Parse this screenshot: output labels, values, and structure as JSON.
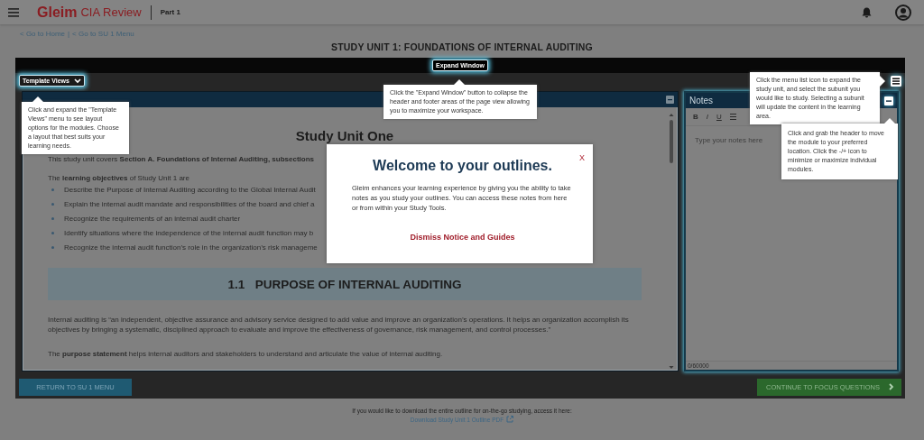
{
  "header": {
    "brand": "Gleim",
    "product": "CIA Review",
    "part": "Part 1"
  },
  "breadcrumbs": {
    "links": [
      "< Go to Home",
      "< Go to SU 1 Menu"
    ],
    "separator": "|"
  },
  "page_title": "STUDY UNIT 1: FOUNDATIONS OF INTERNAL AUDITING",
  "toolbar": {
    "expand_button": "Expand Window",
    "template_views": "Template Views"
  },
  "outline": {
    "title": "Study Unit One",
    "intro": "This study unit covers **Section A. Foundations of Internal Auditing, subsections**",
    "objectives_intro": "The **learning objectives** of Study Unit 1 are",
    "objectives": [
      "Describe the Purpose of Internal Auditing according to the Global Internal Audit",
      "Explain the internal audit mandate and responsibilities of the board and chief a",
      "Recognize the requirements of an internal audit charter",
      "Identify situations where the independence of the internal audit function may b",
      "Recognize the internal audit function’s role in the organization’s risk manageme"
    ],
    "section_heading": "1.1   PURPOSE OF INTERNAL AUDITING",
    "paragraphs": [
      "Internal auditing is “an independent, objective assurance and advisory service designed to add value and improve an organization’s operations. It helps an organization accomplish its objectives by bringing a systematic, disciplined approach to evaluate and improve the effectiveness of governance, risk management, and control processes.”",
      "The **purpose statement** helps internal auditors and stakeholders to understand and articulate the value of internal auditing."
    ]
  },
  "notes": {
    "title": "Notes",
    "format_buttons": [
      "B",
      "I",
      "U"
    ],
    "placeholder": "Type your notes here",
    "counter": "0/60000"
  },
  "footer_buttons": {
    "return": "RETURN TO SU 1 MENU",
    "continue": "CONTINUE TO FOCUS QUESTIONS"
  },
  "download": {
    "text": "If you would like to download the entire outline for on-the-go studying, access it here:",
    "link": "Download Study Unit 1 Outline PDF"
  },
  "tooltips": [
    {
      "kind": "template",
      "text": "Click and expand the \"Template Views\" menu to see layout options for the modules. Choose a layout that best suits your learning needs."
    },
    {
      "kind": "expand",
      "text": "Click the \"Expand Window\" button to collapse the header and footer areas of the page view allowing you to maximize your workspace."
    },
    {
      "kind": "menu",
      "text": "Click the menu list icon to expand the study unit, and select the subunit you would like to study. Selecting a subunit will update the content in the learning area."
    },
    {
      "kind": "grab",
      "text": "Click and grab the header to move the module to your preferred location. Click the -/+ icon to minimize or maximize individual modules."
    }
  ],
  "modal": {
    "close": "X",
    "title": "Welcome to your outlines.",
    "body": "Gleim enhances your learning experience by giving you the ability to take notes as you study your outlines. You can access these notes from here or from within your Study Tools.",
    "action": "Dismiss Notice and Guides"
  }
}
